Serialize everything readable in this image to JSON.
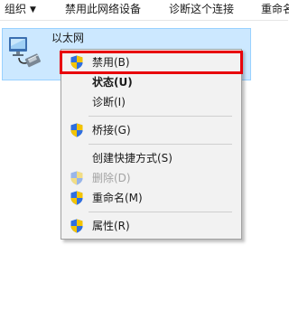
{
  "toolbar": {
    "organize": "组织",
    "disable_device": "禁用此网络设备",
    "diagnose": "诊断这个连接",
    "rename": "重命名"
  },
  "adapter": {
    "name": "以太网",
    "icon": "network-adapter-icon"
  },
  "context_menu": {
    "items": [
      {
        "label": "禁用(B)",
        "icon": "uac-shield-icon"
      },
      {
        "label": "状态(U)"
      },
      {
        "label": "诊断(I)"
      },
      {
        "label": "桥接(G)",
        "icon": "uac-shield-icon"
      },
      {
        "label": "创建快捷方式(S)"
      },
      {
        "label": "删除(D)",
        "icon": "uac-shield-icon",
        "state": "disabled"
      },
      {
        "label": "重命名(M)",
        "icon": "uac-shield-icon"
      },
      {
        "label": "属性(R)",
        "icon": "uac-shield-icon"
      }
    ]
  },
  "colors": {
    "selection_background": "#cce8ff",
    "selection_border": "#99d1ff",
    "highlight_outline": "#e8000b",
    "menu_background": "#f2f2f2"
  }
}
